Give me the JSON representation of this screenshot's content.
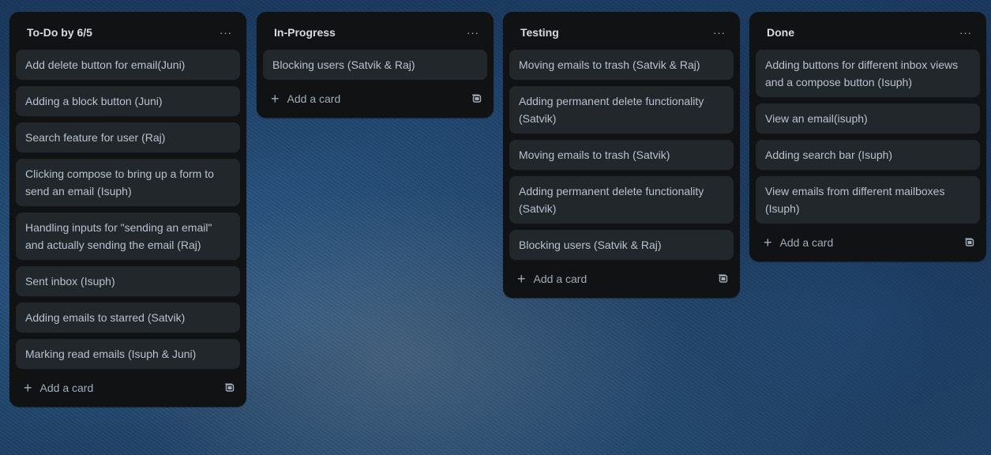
{
  "lists": [
    {
      "title": "To-Do by 6/5",
      "menu": "···",
      "cards": [
        "Add delete button for email(Juni)",
        "Adding a block button (Juni)",
        "Search feature for user (Raj)",
        "Clicking compose to bring up a form to send an email (Isuph)",
        "Handling inputs for \"sending an email\" and actually sending the email (Raj)",
        "Sent inbox (Isuph)",
        "Adding emails to starred (Satvik)",
        "Marking read emails (Isuph & Juni)"
      ],
      "add_label": "Add a card"
    },
    {
      "title": "In-Progress",
      "menu": "···",
      "cards": [
        "Blocking users (Satvik & Raj)"
      ],
      "add_label": "Add a card"
    },
    {
      "title": "Testing",
      "menu": "···",
      "cards": [
        "Moving emails to trash (Satvik & Raj)",
        "Adding permanent delete functionality (Satvik)",
        "Moving emails to trash (Satvik)",
        "Adding permanent delete functionality (Satvik)",
        "Blocking users (Satvik & Raj)"
      ],
      "add_label": "Add a card"
    },
    {
      "title": "Done",
      "menu": "···",
      "cards": [
        "Adding buttons for different inbox views and a compose button (Isuph)",
        "View an email(isuph)",
        "Adding search bar (Isuph)",
        "View emails from different mailboxes (Isuph)"
      ],
      "add_label": "Add a card"
    }
  ],
  "icons": {
    "list_menu": "ellipsis-icon",
    "add": "plus-icon",
    "template": "card-template-icon"
  },
  "colors": {
    "list_bg": "#111214",
    "card_bg": "#22272b",
    "text": "#b6c2cf"
  }
}
